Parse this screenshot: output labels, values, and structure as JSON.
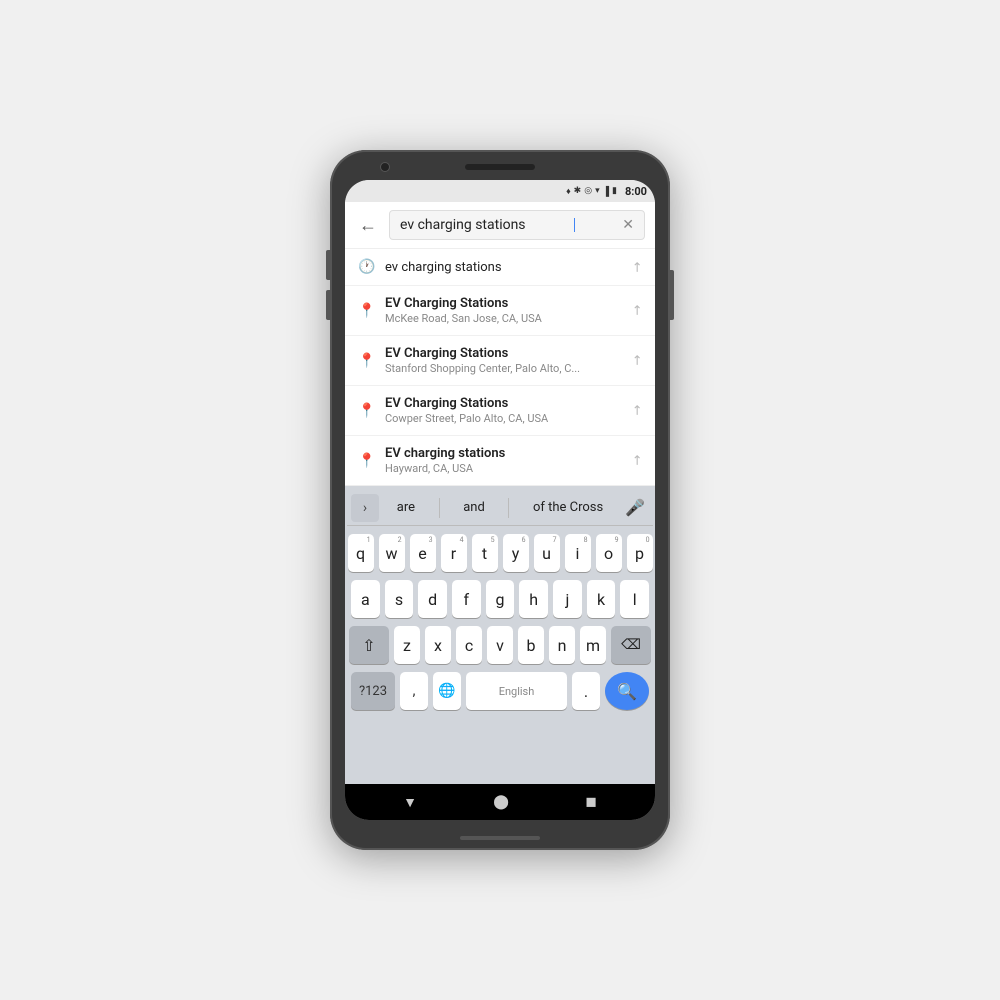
{
  "status_bar": {
    "time": "8:00",
    "icons": [
      "location",
      "bluetooth",
      "circle",
      "wifi",
      "signal",
      "battery"
    ]
  },
  "search": {
    "back_label": "←",
    "query": "ev charging stations",
    "clear_label": "✕"
  },
  "suggestions": [
    {
      "icon_type": "clock",
      "title": "ev charging stations",
      "bold": false,
      "subtitle": null
    },
    {
      "icon_type": "pin",
      "title": "EV Charging Stations",
      "bold": true,
      "subtitle": "McKee Road, San Jose, CA, USA"
    },
    {
      "icon_type": "pin",
      "title": "EV Charging Stations",
      "bold": true,
      "subtitle": "Stanford Shopping Center, Palo Alto, C..."
    },
    {
      "icon_type": "pin",
      "title": "EV Charging Stations",
      "bold": true,
      "subtitle": "Cowper Street, Palo Alto, CA, USA"
    },
    {
      "icon_type": "pin",
      "title": "EV charging stations",
      "bold": true,
      "subtitle": "Hayward, CA, USA"
    }
  ],
  "word_suggestions": [
    "are",
    "and",
    "of the Cross"
  ],
  "keyboard": {
    "row1": [
      {
        "label": "q",
        "num": "1"
      },
      {
        "label": "w",
        "num": "2"
      },
      {
        "label": "e",
        "num": "3"
      },
      {
        "label": "r",
        "num": "4"
      },
      {
        "label": "t",
        "num": "5"
      },
      {
        "label": "y",
        "num": "6"
      },
      {
        "label": "u",
        "num": "7"
      },
      {
        "label": "i",
        "num": "8"
      },
      {
        "label": "o",
        "num": "9"
      },
      {
        "label": "p",
        "num": "0"
      }
    ],
    "row2": [
      {
        "label": "a"
      },
      {
        "label": "s"
      },
      {
        "label": "d"
      },
      {
        "label": "f"
      },
      {
        "label": "g"
      },
      {
        "label": "h"
      },
      {
        "label": "j"
      },
      {
        "label": "k"
      },
      {
        "label": "l"
      }
    ],
    "row3": [
      {
        "label": "z"
      },
      {
        "label": "x"
      },
      {
        "label": "c"
      },
      {
        "label": "v"
      },
      {
        "label": "b"
      },
      {
        "label": "n"
      },
      {
        "label": "m"
      }
    ],
    "bottom": {
      "num_label": "?123",
      "comma_label": ",",
      "globe_label": "🌐",
      "space_label": "English",
      "period_label": ".",
      "search_label": "🔍"
    }
  },
  "nav_bar": {
    "back": "▼",
    "home": "⬤",
    "recent": "◼"
  }
}
